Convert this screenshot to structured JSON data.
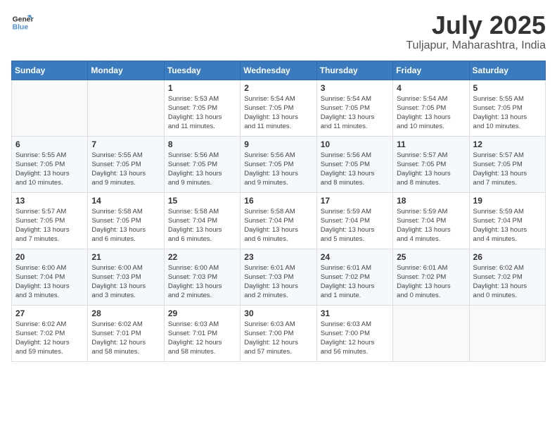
{
  "header": {
    "logo_line1": "General",
    "logo_line2": "Blue",
    "month": "July 2025",
    "location": "Tuljapur, Maharashtra, India"
  },
  "weekdays": [
    "Sunday",
    "Monday",
    "Tuesday",
    "Wednesday",
    "Thursday",
    "Friday",
    "Saturday"
  ],
  "weeks": [
    [
      {
        "day": "",
        "info": ""
      },
      {
        "day": "",
        "info": ""
      },
      {
        "day": "1",
        "info": "Sunrise: 5:53 AM\nSunset: 7:05 PM\nDaylight: 13 hours\nand 11 minutes."
      },
      {
        "day": "2",
        "info": "Sunrise: 5:54 AM\nSunset: 7:05 PM\nDaylight: 13 hours\nand 11 minutes."
      },
      {
        "day": "3",
        "info": "Sunrise: 5:54 AM\nSunset: 7:05 PM\nDaylight: 13 hours\nand 11 minutes."
      },
      {
        "day": "4",
        "info": "Sunrise: 5:54 AM\nSunset: 7:05 PM\nDaylight: 13 hours\nand 10 minutes."
      },
      {
        "day": "5",
        "info": "Sunrise: 5:55 AM\nSunset: 7:05 PM\nDaylight: 13 hours\nand 10 minutes."
      }
    ],
    [
      {
        "day": "6",
        "info": "Sunrise: 5:55 AM\nSunset: 7:05 PM\nDaylight: 13 hours\nand 10 minutes."
      },
      {
        "day": "7",
        "info": "Sunrise: 5:55 AM\nSunset: 7:05 PM\nDaylight: 13 hours\nand 9 minutes."
      },
      {
        "day": "8",
        "info": "Sunrise: 5:56 AM\nSunset: 7:05 PM\nDaylight: 13 hours\nand 9 minutes."
      },
      {
        "day": "9",
        "info": "Sunrise: 5:56 AM\nSunset: 7:05 PM\nDaylight: 13 hours\nand 9 minutes."
      },
      {
        "day": "10",
        "info": "Sunrise: 5:56 AM\nSunset: 7:05 PM\nDaylight: 13 hours\nand 8 minutes."
      },
      {
        "day": "11",
        "info": "Sunrise: 5:57 AM\nSunset: 7:05 PM\nDaylight: 13 hours\nand 8 minutes."
      },
      {
        "day": "12",
        "info": "Sunrise: 5:57 AM\nSunset: 7:05 PM\nDaylight: 13 hours\nand 7 minutes."
      }
    ],
    [
      {
        "day": "13",
        "info": "Sunrise: 5:57 AM\nSunset: 7:05 PM\nDaylight: 13 hours\nand 7 minutes."
      },
      {
        "day": "14",
        "info": "Sunrise: 5:58 AM\nSunset: 7:05 PM\nDaylight: 13 hours\nand 6 minutes."
      },
      {
        "day": "15",
        "info": "Sunrise: 5:58 AM\nSunset: 7:04 PM\nDaylight: 13 hours\nand 6 minutes."
      },
      {
        "day": "16",
        "info": "Sunrise: 5:58 AM\nSunset: 7:04 PM\nDaylight: 13 hours\nand 6 minutes."
      },
      {
        "day": "17",
        "info": "Sunrise: 5:59 AM\nSunset: 7:04 PM\nDaylight: 13 hours\nand 5 minutes."
      },
      {
        "day": "18",
        "info": "Sunrise: 5:59 AM\nSunset: 7:04 PM\nDaylight: 13 hours\nand 4 minutes."
      },
      {
        "day": "19",
        "info": "Sunrise: 5:59 AM\nSunset: 7:04 PM\nDaylight: 13 hours\nand 4 minutes."
      }
    ],
    [
      {
        "day": "20",
        "info": "Sunrise: 6:00 AM\nSunset: 7:04 PM\nDaylight: 13 hours\nand 3 minutes."
      },
      {
        "day": "21",
        "info": "Sunrise: 6:00 AM\nSunset: 7:03 PM\nDaylight: 13 hours\nand 3 minutes."
      },
      {
        "day": "22",
        "info": "Sunrise: 6:00 AM\nSunset: 7:03 PM\nDaylight: 13 hours\nand 2 minutes."
      },
      {
        "day": "23",
        "info": "Sunrise: 6:01 AM\nSunset: 7:03 PM\nDaylight: 13 hours\nand 2 minutes."
      },
      {
        "day": "24",
        "info": "Sunrise: 6:01 AM\nSunset: 7:02 PM\nDaylight: 13 hours\nand 1 minute."
      },
      {
        "day": "25",
        "info": "Sunrise: 6:01 AM\nSunset: 7:02 PM\nDaylight: 13 hours\nand 0 minutes."
      },
      {
        "day": "26",
        "info": "Sunrise: 6:02 AM\nSunset: 7:02 PM\nDaylight: 13 hours\nand 0 minutes."
      }
    ],
    [
      {
        "day": "27",
        "info": "Sunrise: 6:02 AM\nSunset: 7:02 PM\nDaylight: 12 hours\nand 59 minutes."
      },
      {
        "day": "28",
        "info": "Sunrise: 6:02 AM\nSunset: 7:01 PM\nDaylight: 12 hours\nand 58 minutes."
      },
      {
        "day": "29",
        "info": "Sunrise: 6:03 AM\nSunset: 7:01 PM\nDaylight: 12 hours\nand 58 minutes."
      },
      {
        "day": "30",
        "info": "Sunrise: 6:03 AM\nSunset: 7:00 PM\nDaylight: 12 hours\nand 57 minutes."
      },
      {
        "day": "31",
        "info": "Sunrise: 6:03 AM\nSunset: 7:00 PM\nDaylight: 12 hours\nand 56 minutes."
      },
      {
        "day": "",
        "info": ""
      },
      {
        "day": "",
        "info": ""
      }
    ]
  ]
}
